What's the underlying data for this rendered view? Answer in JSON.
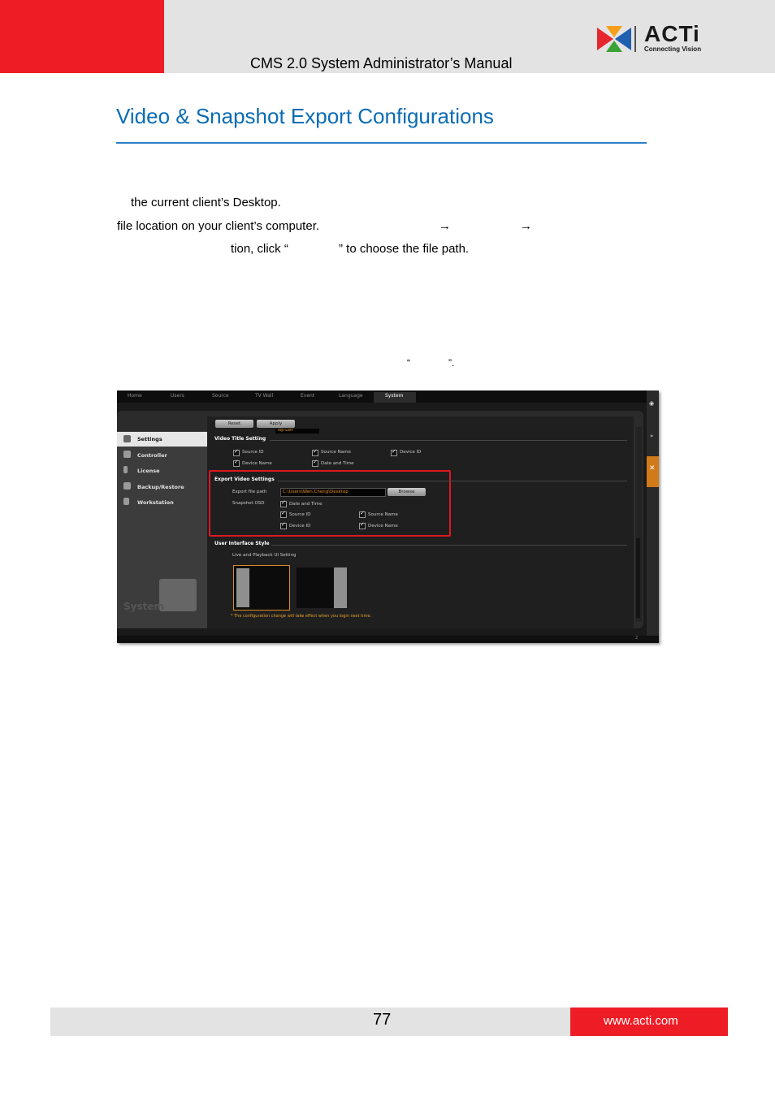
{
  "header": {
    "manual_title": "CMS 2.0 System Administrator’s Manual",
    "logo_word": "ACTi",
    "logo_tagline": "Connecting Vision"
  },
  "section": {
    "title": "Video & Snapshot Export Configurations"
  },
  "body": {
    "line1": "the current client’s Desktop.",
    "line2": "file location on your client’s computer.",
    "arrow1": "→",
    "arrow2": "→",
    "line3": "tion, click “",
    "line3b": "” to choose the file path.",
    "line4a": "“",
    "line4b": "”."
  },
  "screenshot": {
    "tabs": [
      "Home",
      "Users",
      "Source",
      "TV Wall",
      "Event",
      "Language",
      "System"
    ],
    "active_tab": "System",
    "buttons": {
      "reset": "Reset",
      "apply": "Apply"
    },
    "sidebar": [
      "Settings",
      "Controller",
      "License",
      "Backup/Restore",
      "Workstation"
    ],
    "sidebar_caption": "System",
    "partial_field": "Top-Left",
    "video_title": {
      "heading": "Video Title Setting",
      "options": [
        "Source ID",
        "Source Name",
        "Device ID",
        "Device Name",
        "Date and Time"
      ]
    },
    "export": {
      "heading": "Export Video Settings",
      "path_label": "Export file path",
      "path_value": "C:\\Users\\Wen.Cheng\\Desktop",
      "browse": "Browse",
      "osd_label": "Snapshot OSD",
      "osd_options": [
        "Date and Time",
        "Source ID",
        "Source Name",
        "Device ID",
        "Device Name"
      ]
    },
    "ui_style": {
      "heading": "User Interface Style",
      "sub": "Live and Playback UI Setting",
      "note": "* The configuration change will take effect when you login next time."
    },
    "status_count": "2"
  },
  "footer": {
    "page_number": "77",
    "website": "www.acti.com"
  }
}
